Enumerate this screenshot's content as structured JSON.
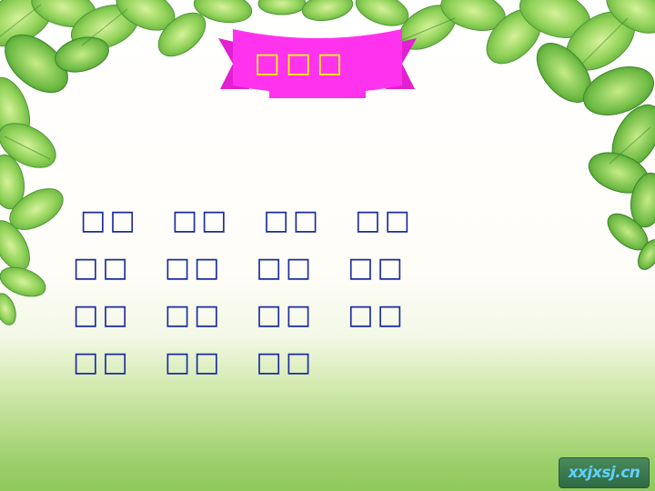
{
  "slide": {
    "banner_title": "□□□",
    "word_rows": [
      [
        "□□",
        "□□",
        "□□",
        "□□"
      ],
      [
        "□□",
        "□□",
        "□□",
        "□□"
      ],
      [
        "□□",
        "□□",
        "□□",
        "□□"
      ],
      [
        "□□",
        "□□",
        "□□"
      ]
    ],
    "watermark": "xxjxsj.cn"
  },
  "colors": {
    "banner_fill": "#ff33ee",
    "banner_text": "#ffff00",
    "word_text": "#1a2d9e",
    "leaf_green": "#7cc44a"
  },
  "icons": [
    "leaf-border-decoration",
    "ribbon-banner"
  ]
}
